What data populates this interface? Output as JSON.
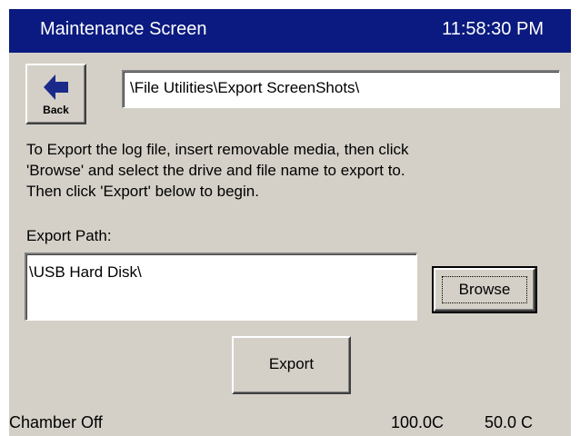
{
  "header": {
    "title": "Maintenance Screen",
    "time": "11:58:30 PM"
  },
  "back_button": {
    "label": "Back",
    "icon": "arrow-left-icon"
  },
  "current_path": "\\File Utilities\\Export ScreenShots\\",
  "instructions": {
    "line1": "To Export the log file, insert removable media, then click",
    "line2": "'Browse' and select the drive and file name to export to.",
    "line3": "Then click 'Export' below to begin."
  },
  "export_path": {
    "label": "Export Path:",
    "value": "\\USB Hard Disk\\"
  },
  "buttons": {
    "browse": "Browse",
    "export": "Export"
  },
  "status": {
    "chamber": "Chamber Off",
    "temperature": "100.0C",
    "setpoint": "50.0 C"
  },
  "colors": {
    "titlebar": "#0a1a80",
    "background": "#d4d0c8",
    "back_arrow": "#1a2a8a"
  }
}
